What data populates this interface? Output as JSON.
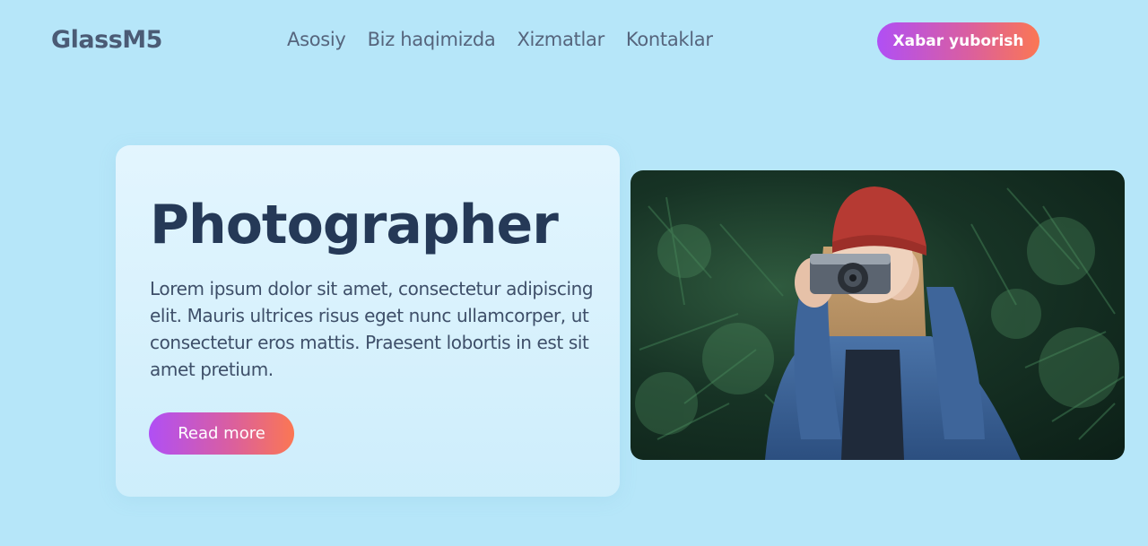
{
  "header": {
    "logo": "GlassM5",
    "nav": [
      {
        "label": "Asosiy"
      },
      {
        "label": "Biz haqimizda"
      },
      {
        "label": "Xizmatlar"
      },
      {
        "label": "Kontaklar"
      }
    ],
    "cta_label": "Xabar yuborish"
  },
  "hero": {
    "title": "Photographer",
    "text": "Lorem ipsum dolor sit amet, consectetur adipiscing elit. Mauris ultrices risus eget nunc ullamcorper, ut consectetur eros mattis. Praesent lobortis in est sit amet pretium.",
    "button_label": "Read more"
  },
  "colors": {
    "background": "#b6e6f9",
    "title": "#253957",
    "gradient_start": "#b04ff5",
    "gradient_end": "#fb7753"
  },
  "icons": {
    "photo": "photographer-with-camera-image"
  }
}
